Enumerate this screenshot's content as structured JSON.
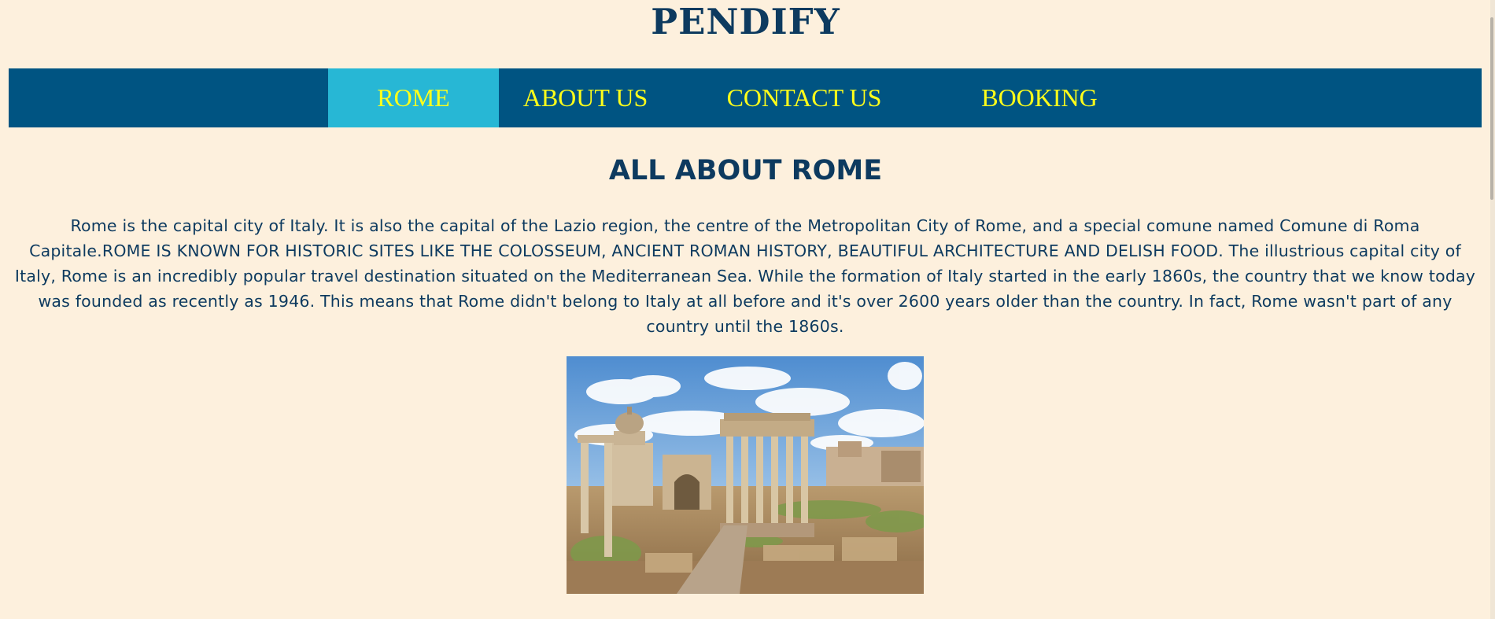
{
  "header": {
    "site_title": "PENDIFY"
  },
  "nav": {
    "items": [
      {
        "label": "ROME",
        "active": true
      },
      {
        "label": "ABOUT US",
        "active": false
      },
      {
        "label": "CONTACT US",
        "active": false
      },
      {
        "label": "BOOKING",
        "active": false
      }
    ]
  },
  "main": {
    "heading": "ALL ABOUT ROME",
    "intro": "Rome is the capital city of Italy. It is also the capital of the Lazio region, the centre of the Metropolitan City of Rome, and a special comune named Comune di Roma Capitale.ROME IS KNOWN FOR HISTORIC SITES LIKE THE COLOSSEUM, ANCIENT ROMAN HISTORY, BEAUTIFUL ARCHITECTURE AND DELISH FOOD. The illustrious capital city of Italy, Rome is an incredibly popular travel destination situated on the Mediterranean Sea. While the formation of Italy started in the early 1860s, the country that we know today was founded as recently as 1946. This means that Rome didn't belong to Italy at all before and it's over 2600 years older than the country. In fact, Rome wasn't part of any country until the 1860s.",
    "image": {
      "icon": "roman-forum-photo"
    }
  },
  "colors": {
    "background": "#fdf0dd",
    "nav_background": "#005482",
    "nav_active": "#27b7d5",
    "nav_text": "#ffff1a",
    "heading_text": "#0d3a5f"
  }
}
